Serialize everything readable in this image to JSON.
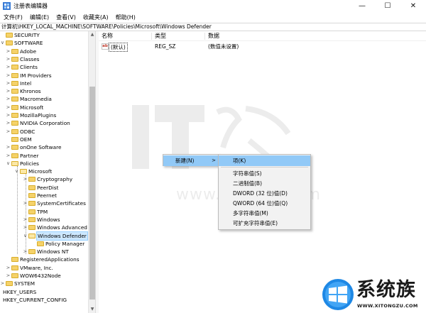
{
  "window": {
    "title": "注册表编辑器",
    "min_glyph": "—",
    "max_glyph": "☐",
    "close_glyph": "✕"
  },
  "menu": [
    "文件(F)",
    "编辑(E)",
    "查看(V)",
    "收藏夹(A)",
    "帮助(H)"
  ],
  "address": "计算机\\HKEY_LOCAL_MACHINE\\SOFTWARE\\Policies\\Microsoft\\Windows Defender",
  "tree": [
    {
      "label": "SECURITY",
      "level": 0,
      "expander": "",
      "folder": false
    },
    {
      "label": "SOFTWARE",
      "level": 0,
      "expander": "∨",
      "folder": false
    },
    {
      "label": "Adobe",
      "level": 1,
      "expander": ">",
      "folder": true
    },
    {
      "label": "Classes",
      "level": 1,
      "expander": ">",
      "folder": true
    },
    {
      "label": "Clients",
      "level": 1,
      "expander": ">",
      "folder": true
    },
    {
      "label": "IM Providers",
      "level": 1,
      "expander": ">",
      "folder": true
    },
    {
      "label": "Intel",
      "level": 1,
      "expander": ">",
      "folder": true
    },
    {
      "label": "Khronos",
      "level": 1,
      "expander": ">",
      "folder": true
    },
    {
      "label": "Macromedia",
      "level": 1,
      "expander": ">",
      "folder": true
    },
    {
      "label": "Microsoft",
      "level": 1,
      "expander": ">",
      "folder": true
    },
    {
      "label": "MozillaPlugins",
      "level": 1,
      "expander": ">",
      "folder": true
    },
    {
      "label": "NVIDIA Corporation",
      "level": 1,
      "expander": ">",
      "folder": true
    },
    {
      "label": "ODBC",
      "level": 1,
      "expander": ">",
      "folder": true
    },
    {
      "label": "OEM",
      "level": 1,
      "expander": "",
      "folder": true
    },
    {
      "label": "onOne Software",
      "level": 1,
      "expander": ">",
      "folder": true
    },
    {
      "label": "Partner",
      "level": 1,
      "expander": ">",
      "folder": true
    },
    {
      "label": "Policies",
      "level": 1,
      "expander": "∨",
      "folder": true,
      "open": true
    },
    {
      "label": "Microsoft",
      "level": 2,
      "expander": "∨",
      "folder": true,
      "open": true
    },
    {
      "label": "Cryptography",
      "level": 3,
      "expander": ">",
      "folder": true
    },
    {
      "label": "PeerDist",
      "level": 3,
      "expander": "",
      "folder": true
    },
    {
      "label": "Peernet",
      "level": 3,
      "expander": "",
      "folder": true
    },
    {
      "label": "SystemCertificates",
      "level": 3,
      "expander": ">",
      "folder": true
    },
    {
      "label": "TPM",
      "level": 3,
      "expander": "",
      "folder": true
    },
    {
      "label": "Windows",
      "level": 3,
      "expander": ">",
      "folder": true
    },
    {
      "label": "Windows Advanced T",
      "level": 3,
      "expander": ">",
      "folder": true
    },
    {
      "label": "Windows Defender",
      "level": 3,
      "expander": "∨",
      "folder": true,
      "open": true,
      "selected": true
    },
    {
      "label": "Policy Manager",
      "level": 4,
      "expander": "",
      "folder": true
    },
    {
      "label": "Windows NT",
      "level": 3,
      "expander": ">",
      "folder": true
    },
    {
      "label": "RegisteredApplications",
      "level": 1,
      "expander": "",
      "folder": true
    },
    {
      "label": "VMware, Inc.",
      "level": 1,
      "expander": ">",
      "folder": true
    },
    {
      "label": "WOW6432Node",
      "level": 1,
      "expander": ">",
      "folder": true
    },
    {
      "label": "SYSTEM",
      "level": 0,
      "expander": ">",
      "folder": true
    },
    {
      "label": "HKEY_USERS",
      "level": -1,
      "expander": ">",
      "folder": false
    },
    {
      "label": "HKEY_CURRENT_CONFIG",
      "level": -1,
      "expander": ">",
      "folder": false
    }
  ],
  "list": {
    "headers": {
      "name": "名称",
      "type": "类型",
      "data": "数据"
    },
    "rows": [
      {
        "icon": "ab",
        "name": "(默认)",
        "type": "REG_SZ",
        "data": "(数值未设置)"
      }
    ]
  },
  "context_menu": {
    "new_label": "新建(N)",
    "arrow": ">",
    "submenu": [
      "项(K)",
      "字符串值(S)",
      "二进制值(B)",
      "DWORD (32 位)值(D)",
      "QWORD (64 位)值(Q)",
      "多字符串值(M)",
      "可扩充字符串值(E)"
    ]
  },
  "watermark": {
    "url": "www.ithome.com"
  },
  "logo": {
    "text": "系统族",
    "url": "WWW.XITONGZU.COM"
  },
  "colors": {
    "highlight": "#91c9f7",
    "selected": "#cde8ff",
    "folder": "#f5d26a",
    "windows_blue": "#1e88e5"
  }
}
